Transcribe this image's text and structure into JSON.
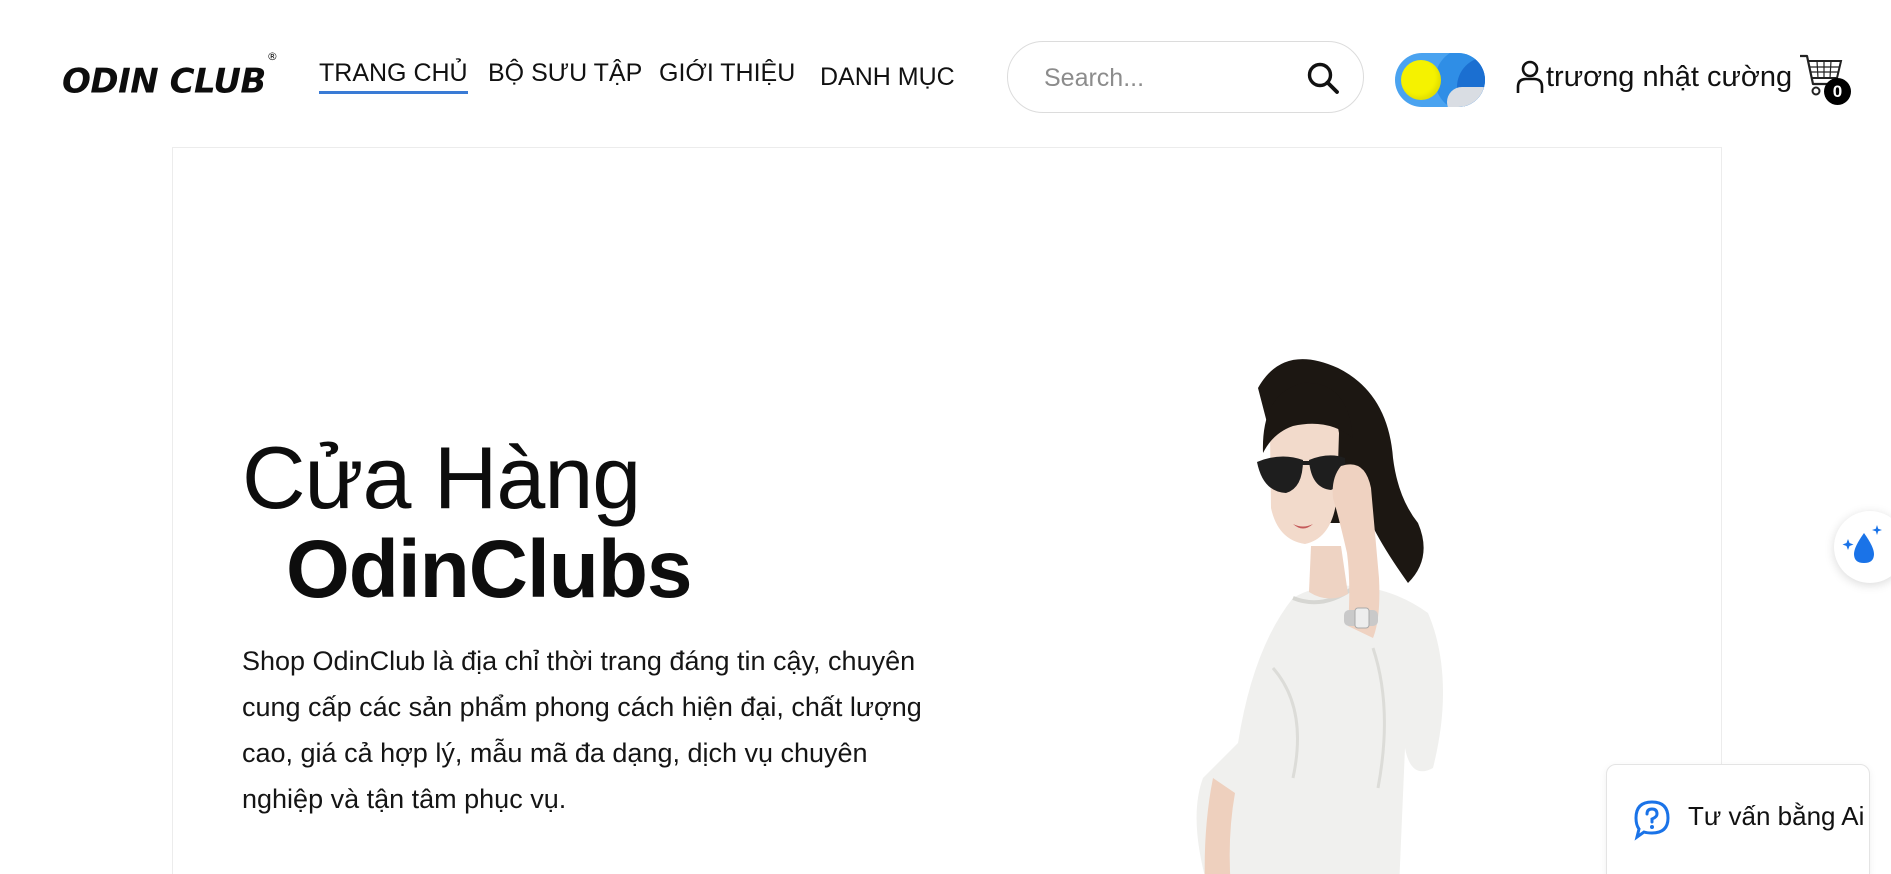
{
  "brand": {
    "name": "ODIN CLUB",
    "trademark": "®"
  },
  "nav": {
    "items": [
      {
        "label": "TRANG CHỦ",
        "active": true
      },
      {
        "label": "BỘ SƯU TẬP",
        "active": false
      },
      {
        "label": "GIỚI THIỆU",
        "active": false
      },
      {
        "label": "DANH MỤC",
        "active": false
      }
    ],
    "active_underline_color": "#3a7bd5"
  },
  "search": {
    "placeholder": "Search...",
    "value": "",
    "icon": "search-icon"
  },
  "theme_toggle": {
    "state": "light",
    "icons": [
      "sun-icon",
      "cloud-icon"
    ]
  },
  "user": {
    "name": "trương nhật cường",
    "icon": "user-icon"
  },
  "cart": {
    "count": "0",
    "icon": "cart-icon"
  },
  "hero": {
    "title_line1": "Cửa Hàng",
    "title_line2": "OdinClubs",
    "description": "Shop OdinClub là địa chỉ thời trang đáng tin cậy, chuyên cung cấp các sản phẩm phong cách hiện đại, chất lượng cao, giá cả hợp lý, mẫu mã đa dạng, dịch vụ chuyên nghiệp và tận tâm phục vụ.",
    "image": "fashion-model-photo"
  },
  "ai_fab": {
    "icon": "sparkle-droplet-icon"
  },
  "ai_chat": {
    "label": "Tư vấn bằng Ai",
    "icon": "chat-question-icon",
    "accent": "#1a73e8"
  }
}
